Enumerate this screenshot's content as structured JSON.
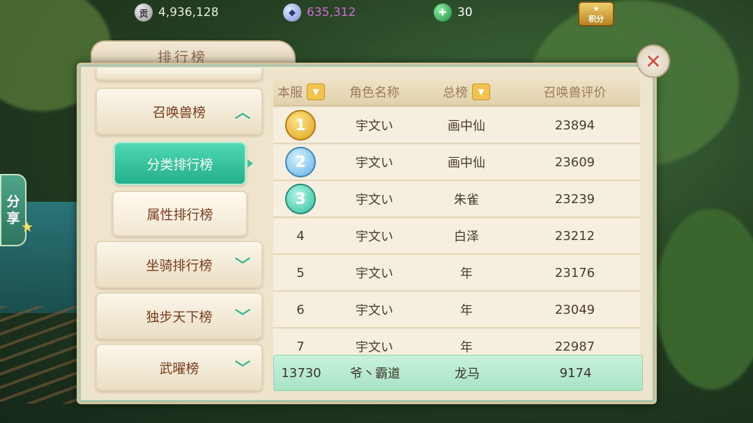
{
  "resources": {
    "silver": {
      "icon": "贡",
      "value": "4,936,128"
    },
    "ingot": {
      "value": "635,312",
      "color": "#d36bd8"
    },
    "jade": {
      "value": "30"
    },
    "points_label": "积分"
  },
  "share": {
    "label_1": "分",
    "label_2": "享"
  },
  "panel": {
    "title": "排行榜",
    "close_symbol": "✕"
  },
  "menu": {
    "summon": "召唤兽榜",
    "category": "分类排行榜",
    "attribute": "属性排行榜",
    "mount": "坐骑排行榜",
    "solo": "独步天下榜",
    "martial": "武曜榜"
  },
  "table": {
    "headers": {
      "server": "本服",
      "name": "角色名称",
      "list": "总榜",
      "score": "召唤兽评价"
    },
    "rows": [
      {
        "rank": "1",
        "name": "宇文い",
        "pet": "画中仙",
        "score": "23894"
      },
      {
        "rank": "2",
        "name": "宇文い",
        "pet": "画中仙",
        "score": "23609"
      },
      {
        "rank": "3",
        "name": "宇文い",
        "pet": "朱雀",
        "score": "23239"
      },
      {
        "rank": "4",
        "name": "宇文い",
        "pet": "白泽",
        "score": "23212"
      },
      {
        "rank": "5",
        "name": "宇文い",
        "pet": "年",
        "score": "23176"
      },
      {
        "rank": "6",
        "name": "宇文い",
        "pet": "年",
        "score": "23049"
      },
      {
        "rank": "7",
        "name": "宇文い",
        "pet": "年",
        "score": "22987"
      }
    ],
    "mine": {
      "rank": "13730",
      "name": "爷丶霸道",
      "pet": "龙马",
      "score": "9174"
    }
  }
}
